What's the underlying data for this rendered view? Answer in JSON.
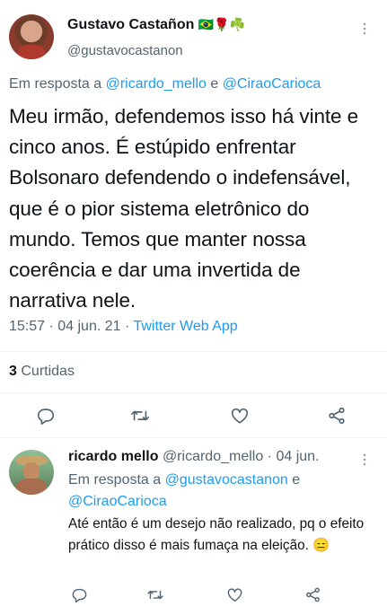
{
  "main_tweet": {
    "author_name": "Gustavo Castañon",
    "author_badges": "🇧🇷🌹☘️",
    "author_handle": "@gustavocastanon",
    "reply_prefix": "Em resposta a ",
    "reply_user1": "@ricardo_mello",
    "reply_join": " e ",
    "reply_user2": "@CiraoCarioca",
    "text": "Meu irmão, defendemos isso há vinte e cinco anos. É estúpido enfrentar Bolsonaro defendendo o indefensável, que é o pior sistema eletrônico do mundo. Temos que manter nossa coerência e dar uma invertida de narrativa nele.",
    "time": "15:57 · 04 jun. 21 · ",
    "source": "Twitter Web App",
    "likes_count": "3",
    "likes_label": "Curtidas"
  },
  "reply_tweet": {
    "author_name": "ricardo mello",
    "author_handle": "@ricardo_mello",
    "date": "· 04 jun.",
    "reply_prefix": "Em resposta a ",
    "reply_user1": "@gustavocastanon",
    "reply_join": " e",
    "reply_user2": "@CiraoCarioca",
    "text": "Até então é um desejo não realizado, pq o efeito prático disso é mais fumaça na eleição.",
    "emoji": "😑"
  },
  "icons": {
    "more": "more-vertical-icon",
    "reply": "reply-icon",
    "retweet": "retweet-icon",
    "like": "heart-icon",
    "share": "share-icon"
  }
}
